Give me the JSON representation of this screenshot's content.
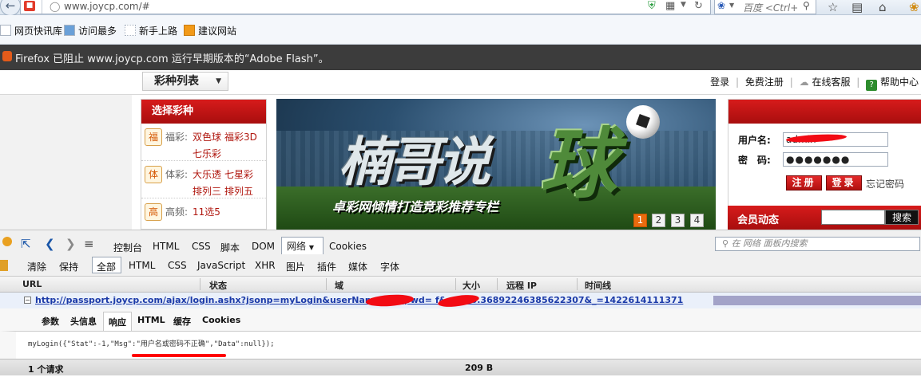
{
  "browser": {
    "url": "www.joycp.com/#",
    "search_placeholder": "百度 <Ctrl+",
    "bookmarks": [
      "网页快讯库",
      "访问最多",
      "新手上路",
      "建议网站"
    ],
    "notification": "Firefox 已阻止 www.joycp.com 运行早期版本的“Adobe Flash”。"
  },
  "page": {
    "select_label": "彩种列表",
    "top_links": [
      "登录",
      "免费注册",
      "在线客服",
      "帮助中心"
    ],
    "lottery_panel_title": "选择彩种",
    "lottery_groups": [
      {
        "category": "福彩:",
        "icon": "福",
        "games": [
          "双色球",
          "福彩3D",
          "七乐彩"
        ]
      },
      {
        "category": "体彩:",
        "icon": "体",
        "games": [
          "大乐透",
          "七星彩",
          "排列三",
          "排列五"
        ]
      },
      {
        "category": "高频:",
        "icon": "高",
        "games": [
          "11选5"
        ]
      }
    ],
    "banner": {
      "title": "楠哥说",
      "title_big": "球",
      "subtitle": "卓彩网倾情打造竞彩推荐专栏",
      "pages": [
        "1",
        "2",
        "3",
        "4"
      ],
      "active_page": "1"
    },
    "login": {
      "username_label": "用户名:",
      "password_label": "密　码:",
      "username_value": "admin",
      "password_value": "●●●●●●●",
      "register_button": "注册",
      "login_button": "登录",
      "forgot_link": "忘记密码"
    },
    "member": {
      "title": "会员动态",
      "search_button": "搜索"
    }
  },
  "devtools": {
    "main_tabs": [
      "控制台",
      "HTML",
      "CSS",
      "脚本",
      "DOM",
      "网络",
      "Cookies"
    ],
    "active_tab": "网络",
    "search_placeholder": "在 网络 面板内搜索",
    "net_toolbar": [
      "清除",
      "保持",
      "全部",
      "HTML",
      "CSS",
      "JavaScript",
      "XHR",
      "图片",
      "插件",
      "媒体",
      "字体"
    ],
    "net_selected_filter": "全部",
    "columns": [
      "URL",
      "状态",
      "域",
      "大小",
      "远程 IP",
      "时间线"
    ],
    "request_url": "http://passport.joycp.com/ajax/login.ashx?jsonp=myLogin&userName=admin&pwd=123456&rnd=0.36892246385622307&_=1422614111371",
    "request_url_display": "http://passport.joycp.com/ajax/login.ashx?jsonp=myLogin&userName=a          &pwd=          f&rnd=0.36892246385622307&_=1422614111371",
    "detail_tabs": [
      "参数",
      "头信息",
      "响应",
      "HTML",
      "缓存",
      "Cookies"
    ],
    "active_detail_tab": "响应",
    "response_text": "myLogin({\"Stat\":-1,\"Msg\":\"用户名或密码不正确\",\"Data\":null});",
    "footer_count": "1 个请求",
    "footer_size": "209 B"
  },
  "colors": {
    "brand_red": "#c8141a",
    "redaction": "#f20b14",
    "devtools_bg": "#f0f0f0"
  }
}
